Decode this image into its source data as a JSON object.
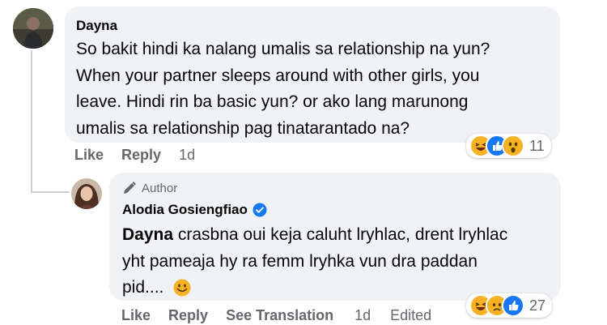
{
  "comment": {
    "author": "Dayna",
    "lines": [
      "So bakit hindi ka nalang umalis sa relationship na yun?",
      "When your partner sleeps around with other girls, you",
      "leave. Hindi rin ba basic yun? or ako lang marunong",
      "umalis sa relationship pag tinatarantado na?"
    ],
    "actions": {
      "like": "Like",
      "reply": "Reply",
      "time": "1d"
    },
    "reactions": {
      "icons": [
        "haha-icon",
        "like-icon",
        "wow-icon"
      ],
      "count": "11"
    }
  },
  "reply": {
    "badge": "Author",
    "author": "Alodia Gosiengfiao",
    "mention": "Dayna",
    "lines": [
      " crasbna oui keja caluht lryhlac, drent lryhlac",
      "yht pameaja hy ra femm lryhka vun dra paddan",
      "pid.... "
    ],
    "actions": {
      "like": "Like",
      "reply": "Reply",
      "translate": "See Translation",
      "time": "1d",
      "edited": "Edited"
    },
    "reactions": {
      "icons": [
        "haha-icon",
        "sad-icon",
        "like-icon"
      ],
      "count": "27"
    }
  },
  "colors": {
    "bubble": "#f0f2f5",
    "verified": "#1877f2",
    "muted": "#65676b"
  }
}
